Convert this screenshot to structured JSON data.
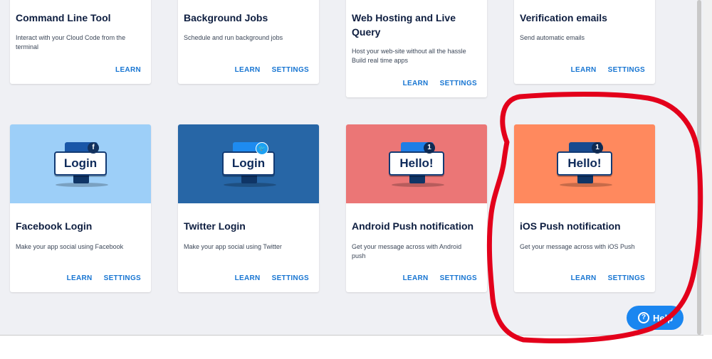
{
  "top_row": [
    {
      "title": "Command Line Tool",
      "description": "Interact with your Cloud Code from the terminal",
      "actions": [
        "LEARN"
      ]
    },
    {
      "title": "Background Jobs",
      "description": "Schedule and run background jobs",
      "actions": [
        "LEARN",
        "SETTINGS"
      ]
    },
    {
      "title": "Web Hosting and Live Query",
      "description": "Host your web-site without all the hassle Build real time apps",
      "actions": [
        "LEARN",
        "SETTINGS"
      ]
    },
    {
      "title": "Verification emails",
      "description": "Send automatic emails",
      "actions": [
        "LEARN",
        "SETTINGS"
      ]
    }
  ],
  "bottom_row": [
    {
      "title": "Facebook Login",
      "description": "Make your app social using Facebook",
      "actions": [
        "LEARN",
        "SETTINGS"
      ],
      "banner_text": "Login",
      "badge": "f",
      "banner_color": "#9dcff8",
      "badge_icon": "facebook-icon"
    },
    {
      "title": "Twitter Login",
      "description": "Make your app social using Twitter",
      "actions": [
        "LEARN",
        "SETTINGS"
      ],
      "banner_text": "Login",
      "badge": "🐦",
      "banner_color": "#2766a6",
      "badge_icon": "twitter-icon"
    },
    {
      "title": "Android Push notification",
      "description": "Get your message across with Android push",
      "actions": [
        "LEARN",
        "SETTINGS"
      ],
      "banner_text": "Hello!",
      "badge": "1",
      "banner_color": "#eb7676",
      "badge_icon": "notification-badge-icon"
    },
    {
      "title": "iOS Push notification",
      "description": "Get your message across with iOS Push",
      "actions": [
        "LEARN",
        "SETTINGS"
      ],
      "banner_text": "Hello!",
      "badge": "1",
      "banner_color": "#ff895e",
      "badge_icon": "notification-badge-icon"
    }
  ],
  "help_button": {
    "label": "Help",
    "icon": "question-circle-icon"
  },
  "colors": {
    "accent": "#1775d2",
    "annotation": "#e3001b",
    "background": "#eff0f4"
  }
}
